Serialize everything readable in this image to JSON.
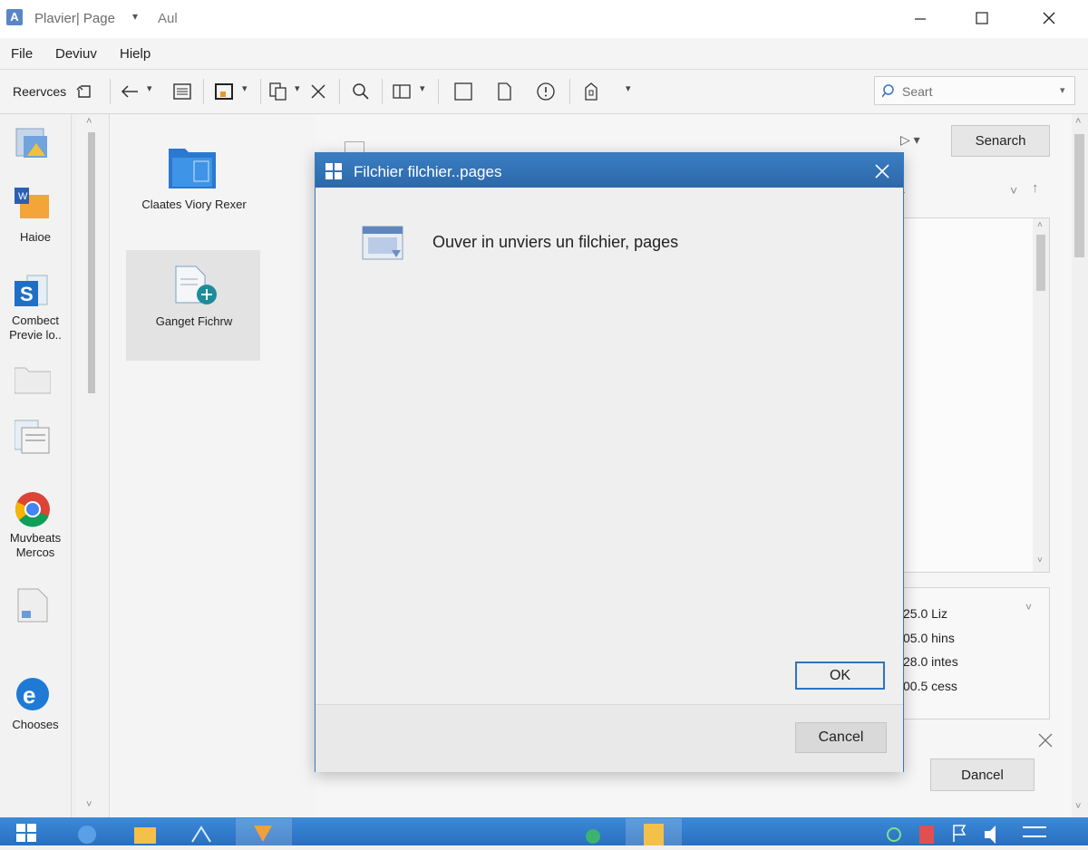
{
  "window": {
    "app_icon_letter": "A",
    "title": "Plavier| Page",
    "title_extra": "Aul",
    "controls": {
      "minimize": "minimize-icon",
      "maximize": "maximize-icon",
      "close": "close-icon"
    }
  },
  "menu": {
    "items": [
      "File",
      "Deviuv",
      "Hielp"
    ]
  },
  "toolbar": {
    "label": "Reervces",
    "icons": [
      "refresh-icon",
      "back-arrow-icon",
      "document-lines-icon",
      "save-icon",
      "copy-icon",
      "cut-icon",
      "search-icon",
      "layout-icon",
      "square-icon",
      "page-icon",
      "info-icon",
      "lock-icon"
    ]
  },
  "search": {
    "placeholder": "Seart",
    "icon": "search-icon"
  },
  "nav": {
    "items": [
      {
        "label": "",
        "icon": "picture-icon"
      },
      {
        "label": "Haioe",
        "icon": "office-folder-icon"
      },
      {
        "label": "Combect Previe lo..",
        "icon": "sharepoint-icon"
      },
      {
        "label": "",
        "icon": "folder-icon"
      },
      {
        "label": "",
        "icon": "document-window-icon"
      },
      {
        "label": "Muvbeats Mercos",
        "icon": "chrome-icon"
      },
      {
        "label": "",
        "icon": "file-icon"
      },
      {
        "label": "Chooses",
        "icon": "edge-icon"
      }
    ]
  },
  "tiles": [
    {
      "label": "Claates Viory Rexer",
      "icon": "blue-folder-icon"
    },
    {
      "label": "Ganget Fichrw",
      "icon": "new-file-icon"
    }
  ],
  "right": {
    "top_button": "Senarch",
    "details": [
      "25.0 Liz",
      "05.0 hins",
      "28.0 intes",
      "00.5 cess"
    ],
    "bottom_button": "Dancel"
  },
  "dialog": {
    "title": "Filchier filchier..pages",
    "message": "Ouver in unviers un filchier, pages",
    "ok_label": "OK",
    "cancel_label": "Cancel"
  },
  "colors": {
    "accent": "#2f6fb0",
    "taskbar": "#2f7cd0",
    "focus": "#2e73c0"
  }
}
